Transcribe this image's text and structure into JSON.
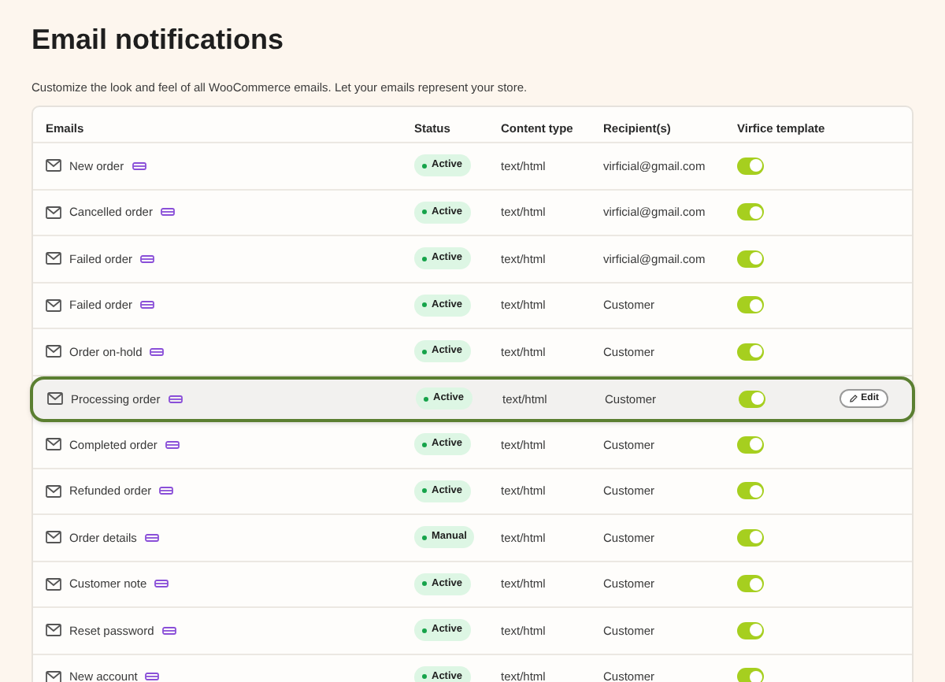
{
  "title": "Email notifications",
  "description": "Customize the look and feel of all WooCommerce emails. Let your emails represent your store.",
  "table": {
    "columns": [
      "Emails",
      "Status",
      "Content type",
      "Recipient(s)",
      "Virfice template"
    ],
    "rows": [
      {
        "email": "New order",
        "status": "Active",
        "content_type": "text/html",
        "recipient": "virficial@gmail.com",
        "template_on": true,
        "selected": false
      },
      {
        "email": "Cancelled order",
        "status": "Active",
        "content_type": "text/html",
        "recipient": "virficial@gmail.com",
        "template_on": true,
        "selected": false
      },
      {
        "email": "Failed order",
        "status": "Active",
        "content_type": "text/html",
        "recipient": "virficial@gmail.com",
        "template_on": true,
        "selected": false
      },
      {
        "email": "Failed order",
        "status": "Active",
        "content_type": "text/html",
        "recipient": "Customer",
        "template_on": true,
        "selected": false
      },
      {
        "email": "Order on-hold",
        "status": "Active",
        "content_type": "text/html",
        "recipient": "Customer",
        "template_on": true,
        "selected": false
      },
      {
        "email": "Processing order",
        "status": "Active",
        "content_type": "text/html",
        "recipient": "Customer",
        "template_on": true,
        "selected": true,
        "action": "Edit"
      },
      {
        "email": "Completed order",
        "status": "Active",
        "content_type": "text/html",
        "recipient": "Customer",
        "template_on": true,
        "selected": false
      },
      {
        "email": "Refunded order",
        "status": "Active",
        "content_type": "text/html",
        "recipient": "Customer",
        "template_on": true,
        "selected": false
      },
      {
        "email": "Order details",
        "status": "Manual",
        "content_type": "text/html",
        "recipient": "Customer",
        "template_on": true,
        "selected": false
      },
      {
        "email": "Customer note",
        "status": "Active",
        "content_type": "text/html",
        "recipient": "Customer",
        "template_on": true,
        "selected": false
      },
      {
        "email": "Reset password",
        "status": "Active",
        "content_type": "text/html",
        "recipient": "Customer",
        "template_on": true,
        "selected": false
      },
      {
        "email": "New account",
        "status": "Active",
        "content_type": "text/html",
        "recipient": "Customer",
        "template_on": true,
        "selected": false
      }
    ]
  }
}
